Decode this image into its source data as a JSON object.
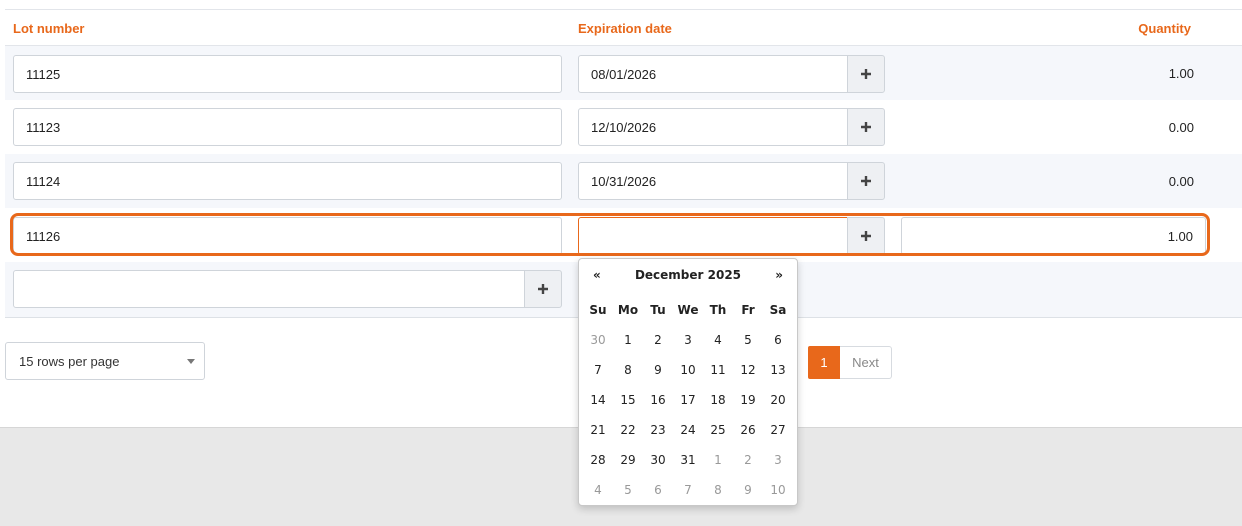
{
  "headers": {
    "lot": "Lot number",
    "expiration": "Expiration date",
    "quantity": "Quantity"
  },
  "rows": [
    {
      "lot": "11125",
      "expiration": "08/01/2026",
      "quantity": "1.00"
    },
    {
      "lot": "11123",
      "expiration": "12/10/2026",
      "quantity": "0.00"
    },
    {
      "lot": "11124",
      "expiration": "10/31/2026",
      "quantity": "0.00"
    },
    {
      "lot": "11126",
      "expiration": "",
      "quantity": "1.00"
    }
  ],
  "new_row": {
    "lot": ""
  },
  "pagination": {
    "rows_per_page": "15 rows per page",
    "current_page": "1",
    "next_label": "Next"
  },
  "calendar": {
    "prev": "«",
    "next": "»",
    "title": "December 2025",
    "weekdays": [
      "Su",
      "Mo",
      "Tu",
      "We",
      "Th",
      "Fr",
      "Sa"
    ],
    "weeks": [
      [
        "30",
        "1",
        "2",
        "3",
        "4",
        "5",
        "6"
      ],
      [
        "7",
        "8",
        "9",
        "10",
        "11",
        "12",
        "13"
      ],
      [
        "14",
        "15",
        "16",
        "17",
        "18",
        "19",
        "20"
      ],
      [
        "21",
        "22",
        "23",
        "24",
        "25",
        "26",
        "27"
      ],
      [
        "28",
        "29",
        "30",
        "31",
        "1",
        "2",
        "3"
      ],
      [
        "4",
        "5",
        "6",
        "7",
        "8",
        "9",
        "10"
      ]
    ]
  },
  "colors": {
    "accent": "#e8681b",
    "row_alt": "#f5f7fb",
    "footer": "#e8e8e8"
  },
  "icons": {
    "add": "plus-icon",
    "dropdown": "caret-down-icon"
  }
}
